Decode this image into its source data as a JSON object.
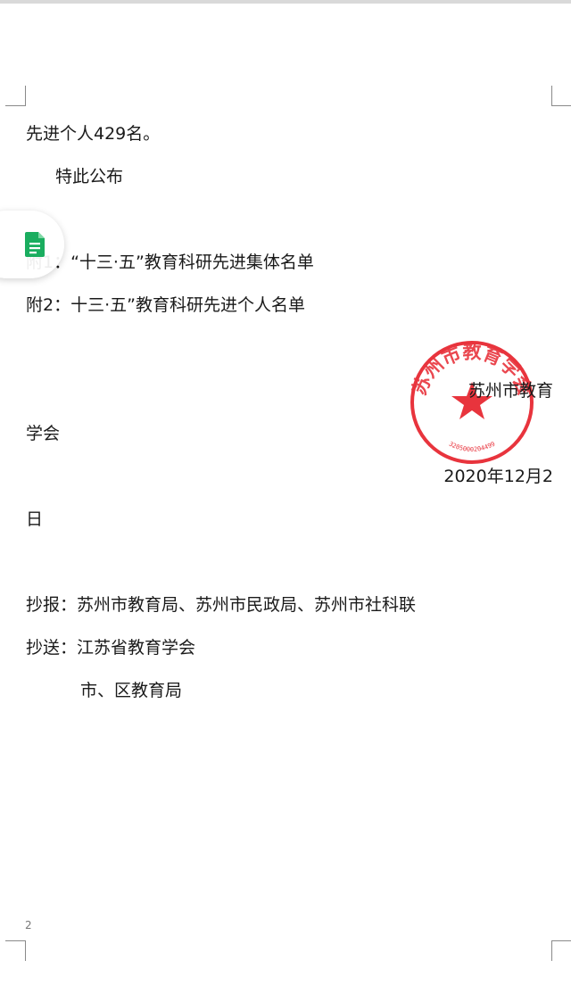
{
  "document": {
    "lines": [
      "先进个人429名。",
      "特此公布",
      "附1：“十三·五”教育科研先进集体名单",
      "附2：十三·五”教育科研先进个人名单",
      "苏州市教育",
      "学会",
      "2020年12月2",
      "日",
      "抄报：苏州市教育局、苏州市民政局、苏州市社科联",
      "抄送：江苏省教育学会",
      "市、区教育局"
    ],
    "page_number": "2"
  },
  "seal": {
    "text": "苏州市教育学会",
    "code": "3205000204499",
    "color": "#e8343d"
  },
  "floating_button": {
    "icon": "doc-icon"
  }
}
